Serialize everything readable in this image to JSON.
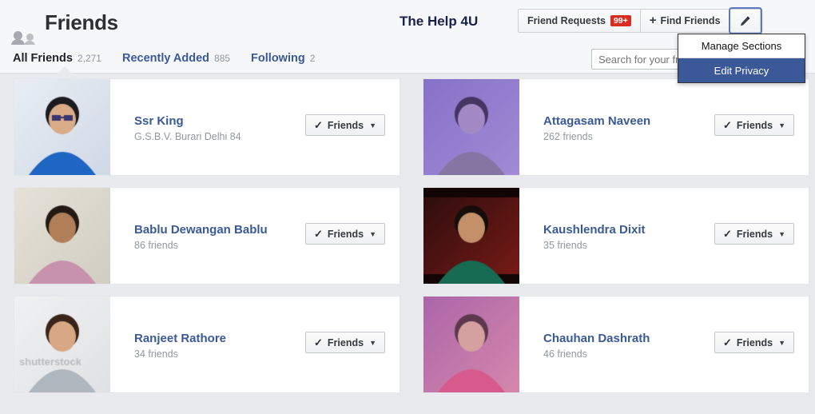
{
  "header": {
    "title": "Friends",
    "friends_icon": "people-icon",
    "account_name": "The Help 4U",
    "buttons": {
      "friend_requests_label": "Friend Requests",
      "friend_requests_badge": "99+",
      "find_friends_plus": "+",
      "find_friends_label": "Find Friends",
      "edit_icon": "pencil-icon"
    }
  },
  "menu": {
    "items": [
      {
        "label": "Manage Sections",
        "active": false
      },
      {
        "label": "Edit Privacy",
        "active": true
      }
    ]
  },
  "tabs": [
    {
      "label": "All Friends",
      "count": "2,271",
      "active": true
    },
    {
      "label": "Recently Added",
      "count": "885",
      "active": false
    },
    {
      "label": "Following",
      "count": "2",
      "active": false
    }
  ],
  "search": {
    "placeholder": "Search for your friends",
    "value": ""
  },
  "friend_button": {
    "check_icon": "check-icon",
    "label": "Friends",
    "caret_icon": "chevron-down-icon"
  },
  "friends": [
    {
      "name": "Ssr King",
      "subtitle": "G.S.B.V. Burari Delhi 84",
      "photo": "boy-sunglasses-blue-jacket"
    },
    {
      "name": "Attagasam Naveen",
      "subtitle": "262 friends",
      "photo": "purple-portrait-sketch"
    },
    {
      "name": "Bablu Dewangan Bablu",
      "subtitle": "86 friends",
      "photo": "man-in-shop-pink-shirt"
    },
    {
      "name": "Kaushlendra Dixit",
      "subtitle": "35 friends",
      "photo": "man-on-sofa-red-curtain"
    },
    {
      "name": "Ranjeet Rathore",
      "subtitle": "34 friends",
      "photo": "man-grey-polo-stock-photo"
    },
    {
      "name": "Chauhan Dashrath",
      "subtitle": "46 friends",
      "photo": "man-pink-shirt-flowers"
    }
  ],
  "colors": {
    "brand_blue": "#3b5998",
    "page_bg": "#e9eaed",
    "badge_red": "#da2d20",
    "muted_text": "#9197a3"
  }
}
